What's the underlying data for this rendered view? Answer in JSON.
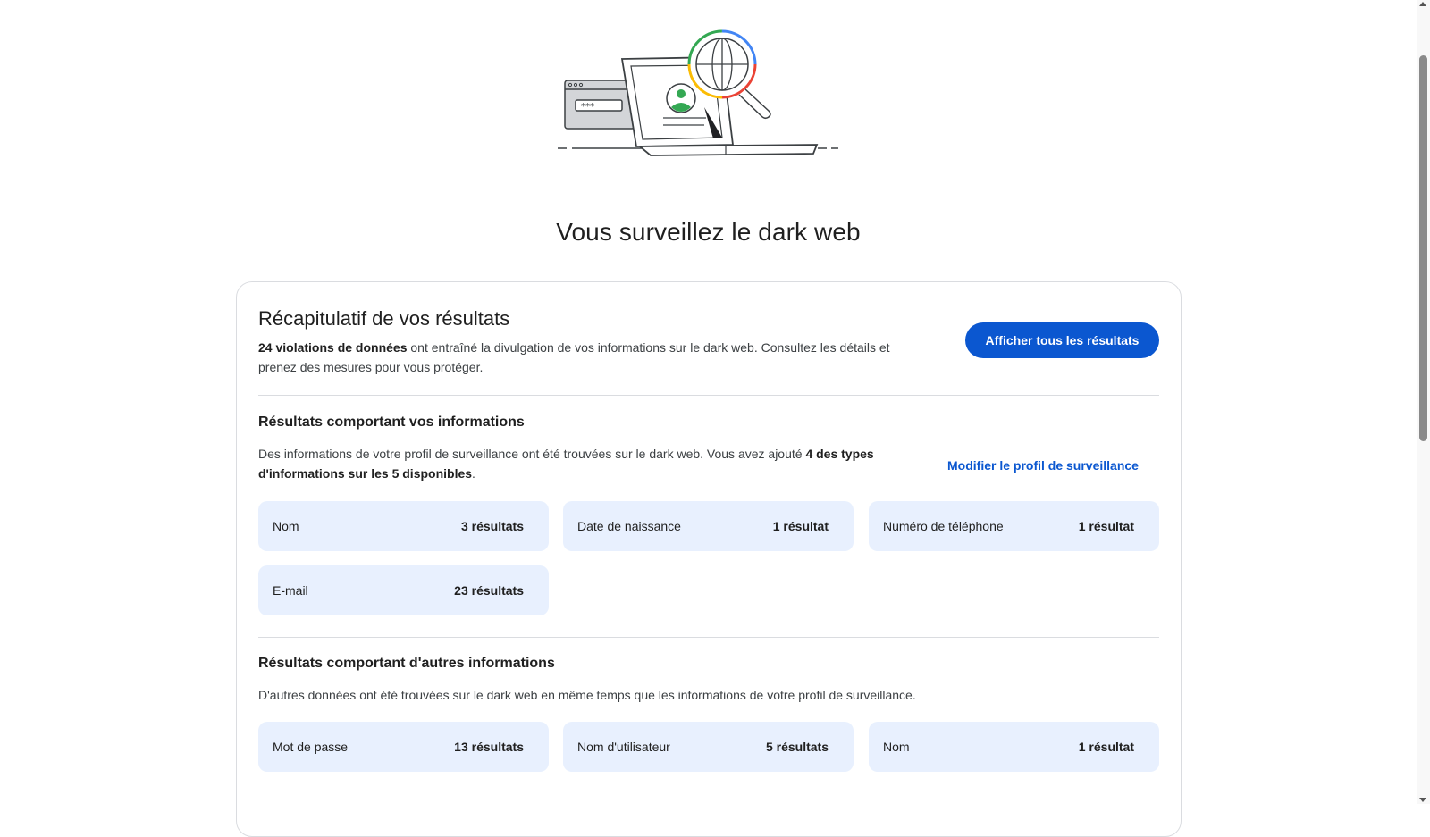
{
  "page": {
    "title": "Vous surveillez le dark web"
  },
  "summary": {
    "title": "Récapitulatif de vos résultats",
    "desc_bold": "24 violations de données",
    "desc_rest": " ont entraîné la divulgation de vos informations sur le dark web. Consultez les détails et prenez des mesures pour vous protéger.",
    "button_label": "Afficher tous les résultats"
  },
  "your_info": {
    "title": "Résultats comportant vos informations",
    "desc_start": "Des informations de votre profil de surveillance ont été trouvées sur le dark web. Vous avez ajouté ",
    "desc_bold": "4 des types d'informations sur les 5 disponibles",
    "desc_end": ".",
    "edit_link": "Modifier le profil de surveillance",
    "tiles": [
      {
        "label": "Nom",
        "count": "3 résultats"
      },
      {
        "label": "Date de naissance",
        "count": "1 résultat"
      },
      {
        "label": "Numéro de téléphone",
        "count": "1 résultat"
      },
      {
        "label": "E-mail",
        "count": "23 résultats"
      }
    ]
  },
  "other_info": {
    "title": "Résultats comportant d'autres informations",
    "desc": "D'autres données ont été trouvées sur le dark web en même temps que les informations de votre profil de surveillance.",
    "tiles": [
      {
        "label": "Mot de passe",
        "count": "13 résultats"
      },
      {
        "label": "Nom d'utilisateur",
        "count": "5 résultats"
      },
      {
        "label": "Nom",
        "count": "1 résultat"
      }
    ]
  },
  "colors": {
    "accent": "#0b57d0",
    "tile_bg": "#e8f0fe",
    "divider": "#dadce0"
  },
  "icons": {
    "hero": "dark-web-monitoring-illustration"
  }
}
